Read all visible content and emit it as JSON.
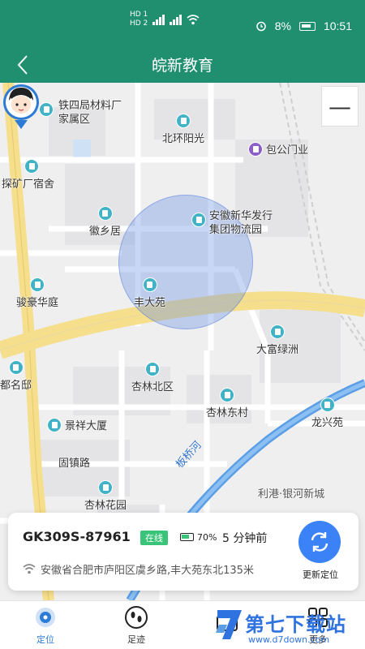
{
  "status_bar": {
    "sim1": "HD 1",
    "sim2": "HD 2",
    "battery": "8%",
    "time": "10:51"
  },
  "header": {
    "title": "皖新教育",
    "back_icon": "chevron-left-icon"
  },
  "map": {
    "pois": [
      {
        "label": "铁四局材料厂",
        "sub": "家属区"
      },
      {
        "label": "北环阳光"
      },
      {
        "label": "包公门业"
      },
      {
        "label": "探矿厂宿舍"
      },
      {
        "label": "徽乡居"
      },
      {
        "label": "安徽新华发行",
        "sub": "集团物流园"
      },
      {
        "label": "骏豪华庭"
      },
      {
        "label": "丰大苑"
      },
      {
        "label": "大富绿洲"
      },
      {
        "label": "都名邸"
      },
      {
        "label": "杏林北区"
      },
      {
        "label": "杏林东村"
      },
      {
        "label": "龙兴苑"
      },
      {
        "label": "景祥大厦"
      },
      {
        "label": "固镇路"
      },
      {
        "label": "杏林花园"
      },
      {
        "label": "利港·银河新城"
      }
    ],
    "road_labels": [
      "板桥河"
    ],
    "zoom_out_label": "—",
    "accent_road_color": "#f5de8c",
    "river_color": "#5b9ee6"
  },
  "device": {
    "id": "GK309S-87961",
    "status": "在线",
    "battery": "70%",
    "last_seen": "5 分钟前",
    "address": "安徽省合肥市庐阳区虞乡路,丰大苑东北135米",
    "refresh_label": "更新定位",
    "status_color": "#3ac47a"
  },
  "bottom_nav": {
    "items": [
      {
        "label": "定位",
        "icon": "location-icon",
        "active": true
      },
      {
        "label": "足迹",
        "icon": "footprint-icon",
        "active": false
      },
      {
        "label": "",
        "icon": "message-icon",
        "active": false
      },
      {
        "label": "更多",
        "icon": "more-grid-icon",
        "active": false
      }
    ]
  },
  "watermark": {
    "title": "第七下载站",
    "url": "www.d7down.com"
  },
  "colors": {
    "brand_green": "#1f8f6f",
    "accent_blue": "#3b82f6"
  }
}
